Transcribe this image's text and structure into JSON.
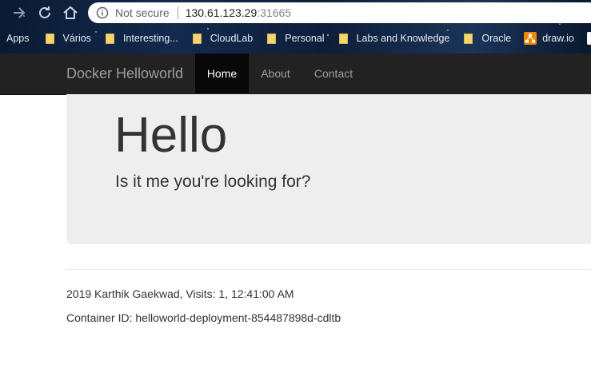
{
  "browser": {
    "omnibox": {
      "security_label": "Not secure",
      "url_host": "130.61.123.29",
      "url_port": ":31665"
    },
    "bookmarks": [
      {
        "label": "Apps",
        "icon": "apps-icon"
      },
      {
        "label": "Vários",
        "icon": "folder-icon"
      },
      {
        "label": "Interesting...",
        "icon": "folder-icon"
      },
      {
        "label": "CloudLab",
        "icon": "folder-icon"
      },
      {
        "label": "Personal",
        "icon": "folder-icon"
      },
      {
        "label": "Labs and Knowledge",
        "icon": "folder-icon"
      },
      {
        "label": "Oracle",
        "icon": "folder-icon"
      },
      {
        "label": "draw.io",
        "icon": "drawio-icon"
      }
    ]
  },
  "navbar": {
    "brand": "Docker Helloworld",
    "items": [
      {
        "label": "Home",
        "active": true
      },
      {
        "label": "About",
        "active": false
      },
      {
        "label": "Contact",
        "active": false
      }
    ]
  },
  "jumbotron": {
    "heading": "Hello",
    "lead": "Is it me you're looking for?"
  },
  "footer": {
    "visits_line": "2019 Karthik Gaekwad, Visits: 1,  12:41:00 AM",
    "container_line": "Container ID: helloworld-deployment-854487898d-cdltb"
  },
  "colors": {
    "navbar_bg": "#222222",
    "navbar_active_bg": "#080808",
    "jumbotron_bg": "#eeeeee"
  }
}
